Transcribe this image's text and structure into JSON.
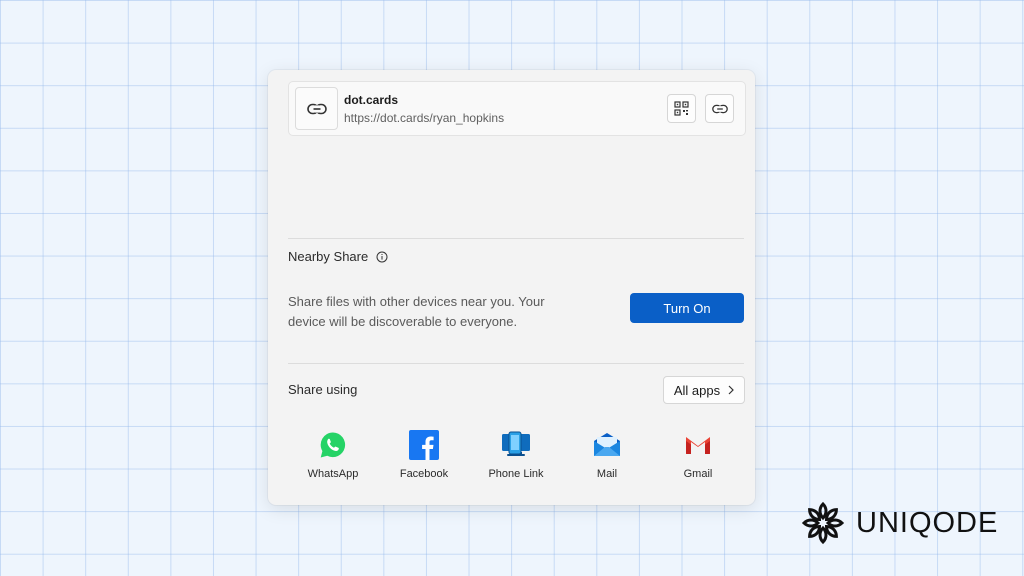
{
  "link": {
    "title": "dot.cards",
    "url": "https://dot.cards/ryan_hopkins",
    "thumb_icon": "link-icon",
    "qr_icon": "qr-code-icon",
    "copy_icon": "copy-link-icon"
  },
  "nearby": {
    "title": "Nearby Share",
    "description": "Share files with other devices near you. Your device will be discoverable to everyone.",
    "button_label": "Turn On",
    "accent": "#0a5fc7"
  },
  "share": {
    "title": "Share using",
    "all_apps_label": "All apps",
    "apps": [
      {
        "label": "WhatsApp",
        "icon": "whatsapp-icon"
      },
      {
        "label": "Facebook",
        "icon": "facebook-icon"
      },
      {
        "label": "Phone Link",
        "icon": "phone-link-icon"
      },
      {
        "label": "Mail",
        "icon": "mail-icon"
      },
      {
        "label": "Gmail",
        "icon": "gmail-icon"
      }
    ]
  },
  "brand": {
    "name": "UNIQODE"
  }
}
